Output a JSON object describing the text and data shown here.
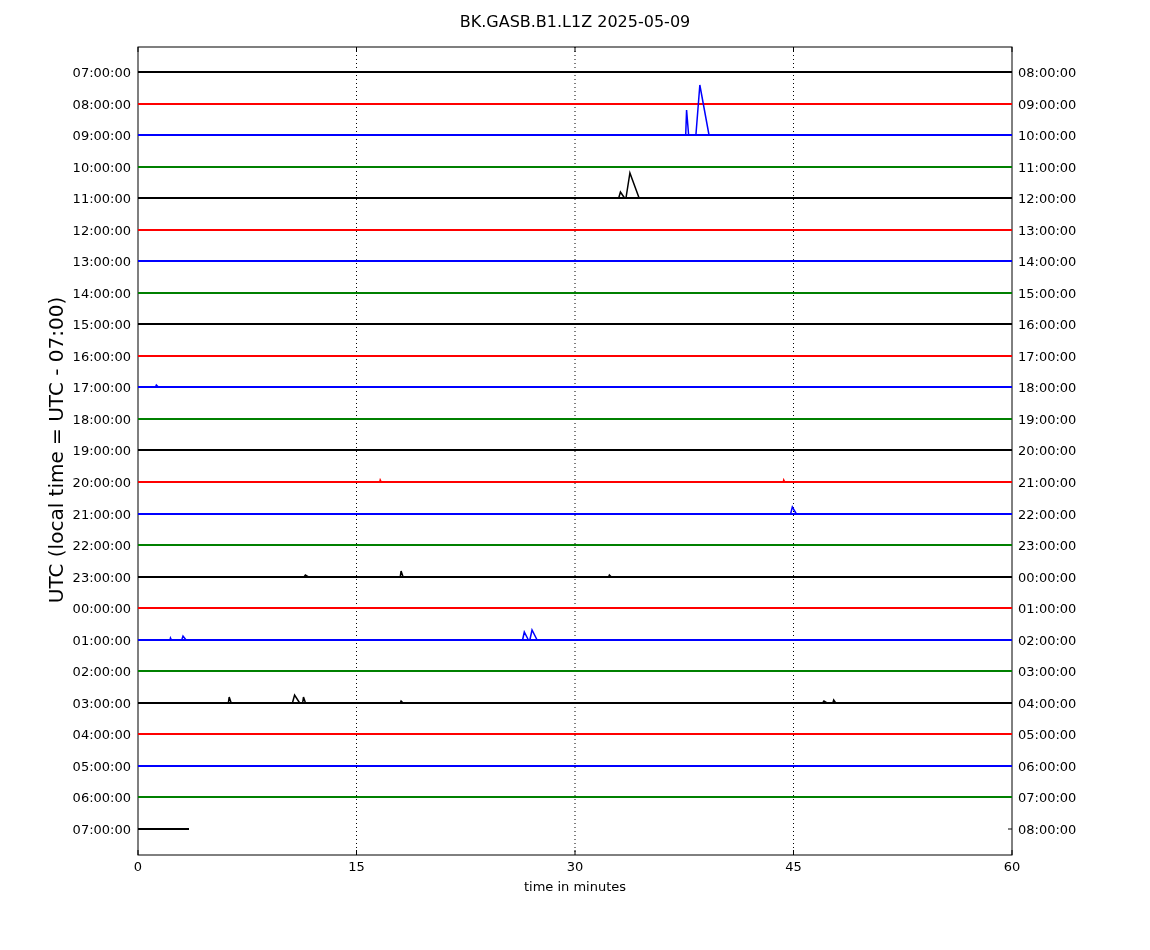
{
  "title": "BK.GASB.B1.L1Z 2025-05-09",
  "ylabel": "UTC (local time = UTC - 07:00)",
  "xlabel": "time in minutes",
  "xticks": [
    "0",
    "15",
    "30",
    "45",
    "60"
  ],
  "rows": [
    {
      "left": "07:00:00",
      "right": "08:00:00",
      "color": "#000000",
      "level": 1
    },
    {
      "left": "08:00:00",
      "right": "09:00:00",
      "color": "#ff0000",
      "level": 1
    },
    {
      "left": "09:00:00",
      "right": "10:00:00",
      "color": "#0000ff",
      "level": 1
    },
    {
      "left": "10:00:00",
      "right": "11:00:00",
      "color": "#008000",
      "level": 1
    },
    {
      "left": "11:00:00",
      "right": "12:00:00",
      "color": "#000000",
      "level": 1
    },
    {
      "left": "12:00:00",
      "right": "13:00:00",
      "color": "#ff0000",
      "level": 1
    },
    {
      "left": "13:00:00",
      "right": "14:00:00",
      "color": "#0000ff",
      "level": 1
    },
    {
      "left": "14:00:00",
      "right": "15:00:00",
      "color": "#008000",
      "level": 1
    },
    {
      "left": "15:00:00",
      "right": "16:00:00",
      "color": "#000000",
      "level": 1
    },
    {
      "left": "16:00:00",
      "right": "17:00:00",
      "color": "#ff0000",
      "level": 1
    },
    {
      "left": "17:00:00",
      "right": "18:00:00",
      "color": "#0000ff",
      "level": 1
    },
    {
      "left": "18:00:00",
      "right": "19:00:00",
      "color": "#008000",
      "level": 1
    },
    {
      "left": "19:00:00",
      "right": "20:00:00",
      "color": "#000000",
      "level": 1
    },
    {
      "left": "20:00:00",
      "right": "21:00:00",
      "color": "#ff0000",
      "level": 1
    },
    {
      "left": "21:00:00",
      "right": "22:00:00",
      "color": "#0000ff",
      "level": 1
    },
    {
      "left": "22:00:00",
      "right": "23:00:00",
      "color": "#008000",
      "level": 1
    },
    {
      "left": "23:00:00",
      "right": "00:00:00",
      "color": "#000000",
      "level": 1
    },
    {
      "left": "00:00:00",
      "right": "01:00:00",
      "color": "#ff0000",
      "level": 1
    },
    {
      "left": "01:00:00",
      "right": "02:00:00",
      "color": "#0000ff",
      "level": 1
    },
    {
      "left": "02:00:00",
      "right": "03:00:00",
      "color": "#008000",
      "level": 1
    },
    {
      "left": "03:00:00",
      "right": "04:00:00",
      "color": "#000000",
      "level": 1
    },
    {
      "left": "04:00:00",
      "right": "05:00:00",
      "color": "#ff0000",
      "level": 1
    },
    {
      "left": "05:00:00",
      "right": "06:00:00",
      "color": "#0000ff",
      "level": 1
    },
    {
      "left": "06:00:00",
      "right": "07:00:00",
      "color": "#008000",
      "level": 1
    },
    {
      "left": "07:00:00",
      "right": "08:00:00",
      "color": "#000000",
      "level": 0.058
    }
  ]
}
